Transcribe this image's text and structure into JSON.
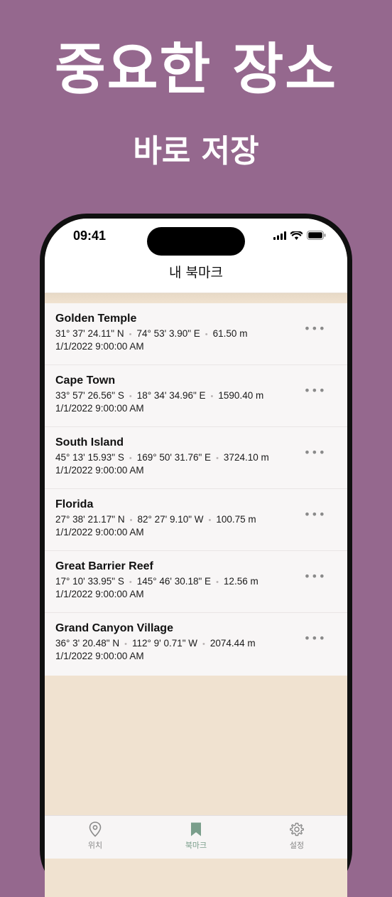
{
  "promo": {
    "headline": "중요한 장소",
    "subheadline": "바로 저장"
  },
  "status_bar": {
    "time": "09:41"
  },
  "header": {
    "title": "내 북마크"
  },
  "bookmarks": [
    {
      "name": "Golden Temple",
      "lat": "31° 37' 24.11\" N",
      "lon": "74° 53' 3.90\" E",
      "alt": "61.50 m",
      "date": "1/1/2022 9:00:00 AM"
    },
    {
      "name": "Cape Town",
      "lat": "33° 57' 26.56\" S",
      "lon": "18° 34' 34.96\" E",
      "alt": "1590.40 m",
      "date": "1/1/2022 9:00:00 AM"
    },
    {
      "name": "South Island",
      "lat": "45° 13' 15.93\" S",
      "lon": "169° 50' 31.76\" E",
      "alt": "3724.10 m",
      "date": "1/1/2022 9:00:00 AM"
    },
    {
      "name": "Florida",
      "lat": "27° 38' 21.17\" N",
      "lon": "82° 27' 9.10\" W",
      "alt": "100.75 m",
      "date": "1/1/2022 9:00:00 AM"
    },
    {
      "name": "Great Barrier Reef",
      "lat": "17° 10' 33.95\" S",
      "lon": "145° 46' 30.18\" E",
      "alt": "12.56 m",
      "date": "1/1/2022 9:00:00 AM"
    },
    {
      "name": "Grand Canyon Village",
      "lat": "36° 3' 20.48\" N",
      "lon": "112° 9' 0.71\" W",
      "alt": "2074.44 m",
      "date": "1/1/2022 9:00:00 AM"
    }
  ],
  "more_label": "•••",
  "separator": "•",
  "tabs": [
    {
      "label": "위치",
      "icon": "location-pin-icon"
    },
    {
      "label": "북마크",
      "icon": "bookmark-icon"
    },
    {
      "label": "설정",
      "icon": "gear-icon"
    }
  ],
  "colors": {
    "background": "#95688E",
    "accent": "#7A9E8B",
    "content_background": "#F0E2D0"
  }
}
